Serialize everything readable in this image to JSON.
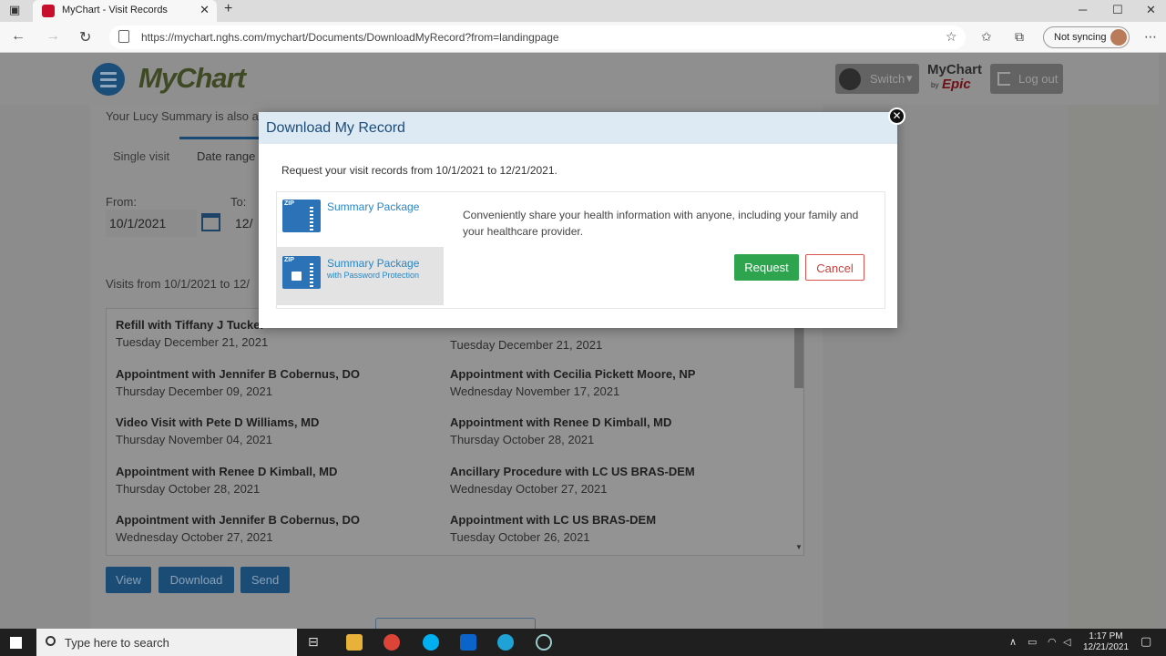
{
  "browser": {
    "tab_title": "MyChart - Visit Records",
    "url": "https://mychart.nghs.com/mychart/Documents/DownloadMyRecord?from=landingpage",
    "sync_label": "Not syncing"
  },
  "header": {
    "logo": "MyChart",
    "switch_label": "Switch",
    "epic_brand_top": "MyChart",
    "epic_brand_by": "by",
    "epic_brand": "Epic",
    "logout_label": "Log out"
  },
  "main": {
    "intro_text": "Your Lucy Summary is also a",
    "tabs": [
      "Single visit",
      "Date range"
    ],
    "from_label": "From:",
    "to_label": "To:",
    "from_value": "10/1/2021",
    "to_value_partial": "12/",
    "visits_from_label": "Visits from 10/1/2021 to 12/",
    "visits": [
      {
        "title": "Refill with Tiffany J Tucker",
        "date": "Tuesday December 21, 2021"
      },
      {
        "title": "",
        "date": "Tuesday December 21, 2021"
      },
      {
        "title": "Appointment with Jennifer B Cobernus, DO",
        "date": "Thursday December 09, 2021"
      },
      {
        "title": "Appointment with Cecilia Pickett Moore, NP",
        "date": "Wednesday November 17, 2021"
      },
      {
        "title": "Video Visit with Pete D Williams, MD",
        "date": "Thursday November 04, 2021"
      },
      {
        "title": "Appointment with Renee D Kimball, MD",
        "date": "Thursday October 28, 2021"
      },
      {
        "title": "Appointment with Renee D Kimball, MD",
        "date": "Thursday October 28, 2021"
      },
      {
        "title": "Ancillary Procedure with LC US BRAS-DEM",
        "date": "Wednesday October 27, 2021"
      },
      {
        "title": "Appointment with Jennifer B Cobernus, DO",
        "date": "Wednesday October 27, 2021"
      },
      {
        "title": "Appointment with LC US BRAS-DEM",
        "date": "Tuesday October 26, 2021"
      }
    ],
    "actions": {
      "view": "View",
      "download": "Download",
      "send": "Send"
    }
  },
  "modal": {
    "title": "Download My Record",
    "request_text": "Request your visit records from 10/1/2021 to 12/21/2021.",
    "option1_label": "Summary Package",
    "option2_label": "Summary Package",
    "option2_sub": "with Password Protection",
    "zip_tag": "ZIP",
    "description": "Conveniently share your health information with anyone, including your family and your healthcare provider.",
    "request_button": "Request",
    "cancel_button": "Cancel"
  },
  "taskbar": {
    "search_placeholder": "Type here to search",
    "time": "1:17 PM",
    "date": "12/21/2021"
  }
}
